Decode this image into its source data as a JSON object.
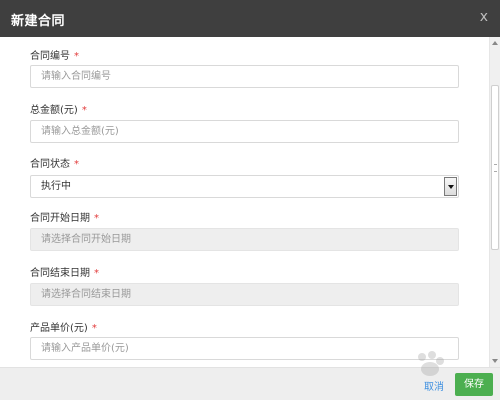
{
  "dialog": {
    "title": "新建合同",
    "close_glyph": "x"
  },
  "form": {
    "fields": [
      {
        "label": "合同编号",
        "required": "*",
        "placeholder": "请输入合同编号"
      },
      {
        "label": "总金额(元)",
        "required": "*",
        "placeholder": "请输入总金额(元)"
      },
      {
        "label": "合同状态",
        "required": "*",
        "value": "执行中"
      },
      {
        "label": "合同开始日期",
        "required": "*",
        "placeholder": "请选择合同开始日期"
      },
      {
        "label": "合同结束日期",
        "required": "*",
        "placeholder": "请选择合同结束日期"
      },
      {
        "label": "产品单价(元)",
        "required": "*",
        "placeholder": "请输入产品单价(元)"
      }
    ]
  },
  "footer": {
    "cancel_label": "取消",
    "save_label": "保存"
  },
  "icons": {
    "close": "close-icon",
    "dropdown": "chevron-down-icon"
  },
  "colors": {
    "header_bg": "#3f3f3f",
    "required": "#e23a3a",
    "save_button": "#4caf50",
    "cancel_link": "#3d8fe0"
  }
}
